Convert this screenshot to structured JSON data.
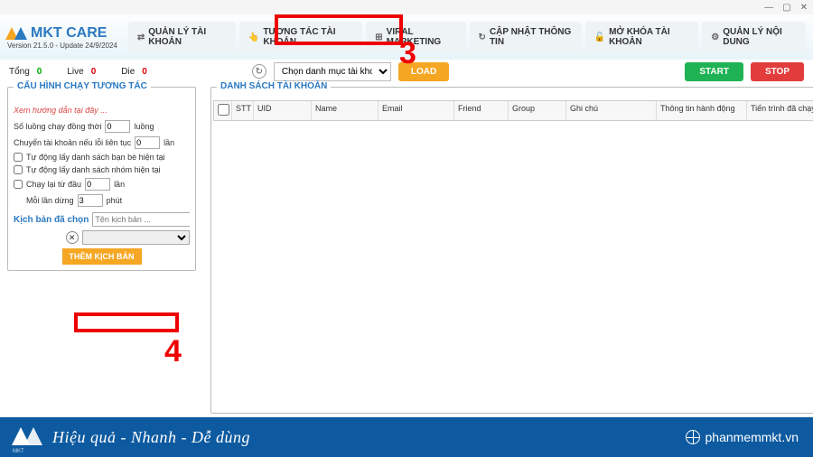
{
  "titlebar": {
    "min": "—",
    "max": "▢",
    "close": "✕"
  },
  "logo": {
    "name": "MKT CARE",
    "version": "Version  21.5.0 - Update  24/9/2024"
  },
  "tabs": [
    {
      "icon": "⇄",
      "label": "QUẢN LÝ TÀI KHOẢN"
    },
    {
      "icon": "👆",
      "label": "TƯƠNG TÁC TÀI KHOẢN"
    },
    {
      "icon": "⊞",
      "label": "VIRAL MARKETING"
    },
    {
      "icon": "↻",
      "label": "CẬP NHẬT THÔNG TIN"
    },
    {
      "icon": "🔓",
      "label": "MỞ KHÓA TÀI KHOẢN"
    },
    {
      "icon": "⚙",
      "label": "QUẢN LÝ NỘI DUNG"
    }
  ],
  "annot": {
    "three": "3",
    "four": "4"
  },
  "stats": {
    "tong_lbl": "Tổng",
    "tong_val": "0",
    "live_lbl": "Live",
    "live_val": "0",
    "die_lbl": "Die",
    "die_val": "0",
    "category_ph": "Chọn danh mục tài khoản",
    "load": "LOAD",
    "start": "START",
    "stop": "STOP"
  },
  "leftpanel": {
    "title": "CẤU HÌNH CHẠY TƯƠNG TÁC",
    "hint": "Xem hướng dẫn tại đây ...",
    "r1a": "Số luồng chạy đồng thời",
    "r1v": "0",
    "r1b": "luồng",
    "r2a": "Chuyển tài khoản nếu lỗi liên tục",
    "r2v": "0",
    "r2b": "lần",
    "cb1": "Tự động lấy danh sách bạn bè hiện tại",
    "cb2": "Tự động lấy danh sách nhóm hiện tại",
    "r3a": "Chạy lại từ đầu",
    "r3v": "0",
    "r3b": "lần",
    "r4a": "Mỗi lần dừng",
    "r4v": "3",
    "r4b": "phút",
    "kb_lbl": "Kịch bản đã chọn",
    "kb_ph": "Tên kịch bản ...",
    "kb_btn": "THÊM KỊCH BẢN"
  },
  "rightpanel": {
    "title": "DANH SÁCH TÀI KHOẢN",
    "cols": {
      "stt": "STT",
      "uid": "UID",
      "name": "Name",
      "email": "Email",
      "friend": "Friend",
      "group": "Group",
      "note": "Ghi chú",
      "act": "Thông tin hành động",
      "prog": "Tiến trình đã chạy"
    }
  },
  "footer": {
    "brand": "MKT",
    "slogan": "Hiệu quả - Nhanh - Dễ dùng",
    "site": "phanmemmkt.vn"
  }
}
